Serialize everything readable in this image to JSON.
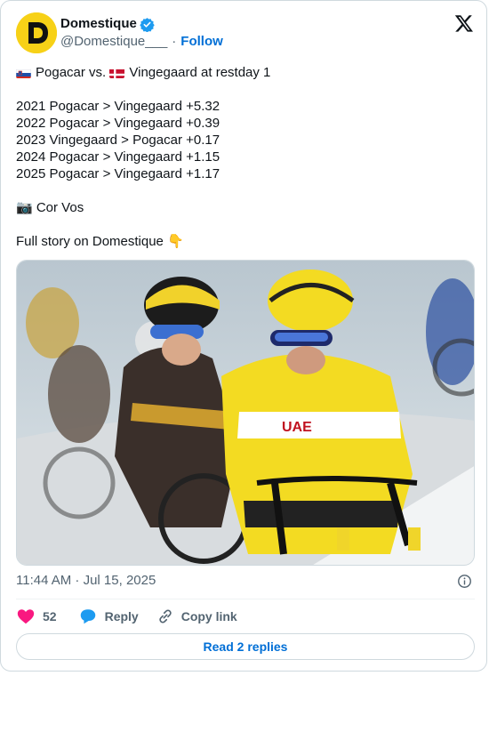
{
  "author": {
    "name": "Domestique",
    "handle": "@Domestique___",
    "follow_label": "Follow",
    "separator": "·"
  },
  "tweet": {
    "line1_a": "Pogacar vs.",
    "line1_b": "Vingegaard at restday 1",
    "results": [
      "2021 Pogacar > Vingegaard +5.32",
      "2022 Pogacar > Vingegaard +0.39",
      "2023 Vingegaard > Pogacar +0.17",
      "2024 Pogacar > Vingegaard +1.15",
      "2025 Pogacar > Vingegaard +1.17"
    ],
    "credit": "📷 Cor Vos",
    "cta": "Full story on Domestique 👇"
  },
  "timestamp": "11:44 AM · Jul 15, 2025",
  "actions": {
    "likes": "52",
    "reply_label": "Reply",
    "copy_label": "Copy link"
  },
  "read_replies_label": "Read 2 replies",
  "colors": {
    "accent": "#006fd6",
    "like": "#f91880",
    "verified": "#1d9bf0",
    "avatar_bg": "#f7d117"
  },
  "icons": [
    "verified-badge-icon",
    "x-logo-icon",
    "info-icon",
    "heart-icon",
    "reply-icon",
    "link-icon",
    "slovenia-flag-icon",
    "denmark-flag-icon"
  ]
}
